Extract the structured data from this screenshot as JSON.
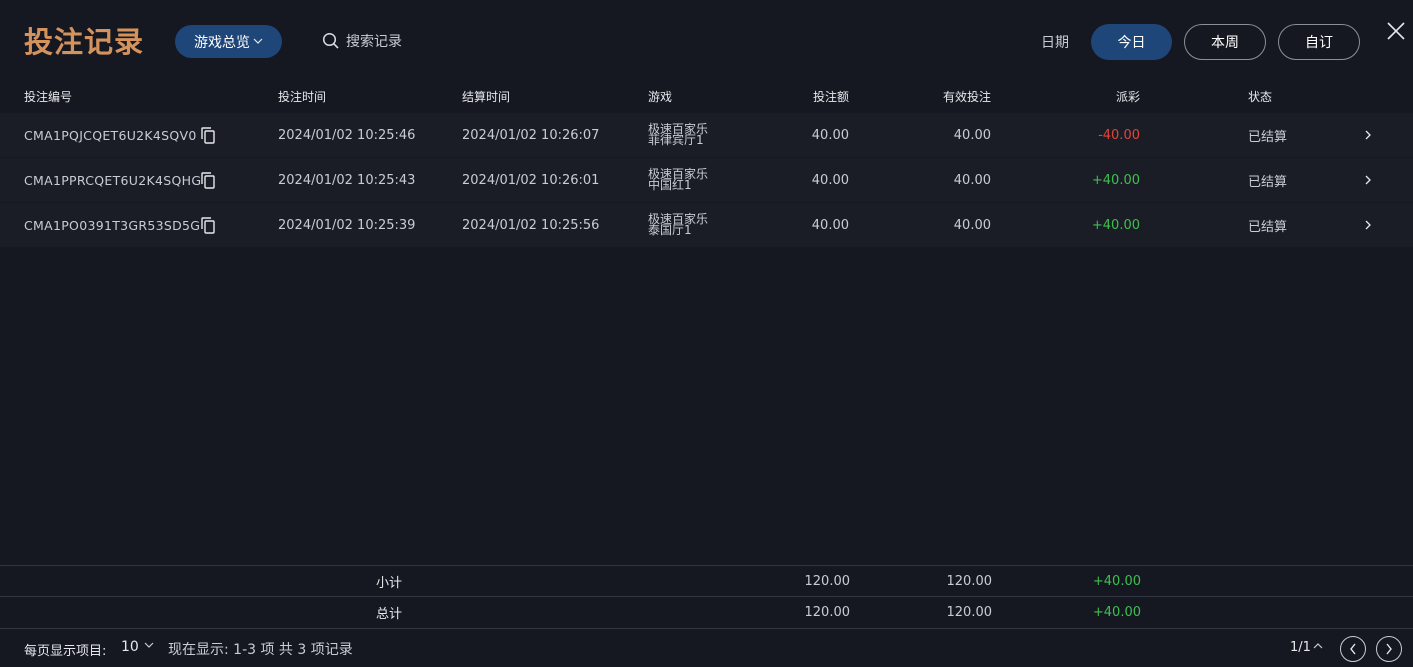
{
  "header": {
    "title": "投注记录",
    "game_select": "游戏总览",
    "search_placeholder": "搜索记录",
    "date_label": "日期",
    "date_filters": [
      "今日",
      "本周",
      "自订"
    ],
    "active_filter": "今日"
  },
  "columns": [
    "投注编号",
    "投注时间",
    "结算时间",
    "游戏",
    "投注额",
    "有效投注",
    "派彩",
    "状态"
  ],
  "rows": [
    {
      "id": "CMA1PQJCQET6U2K4SQV0",
      "bet_time": "2024/01/02 10:25:46",
      "settle_time": "2024/01/02 10:26:07",
      "game_line1": "极速百家乐",
      "game_line2": "菲律宾厅1",
      "bet": "40.00",
      "valid": "40.00",
      "payout": "-40.00",
      "payout_sign": "neg",
      "status": "已结算"
    },
    {
      "id": "CMA1PPRCQET6U2K4SQHG",
      "bet_time": "2024/01/02 10:25:43",
      "settle_time": "2024/01/02 10:26:01",
      "game_line1": "极速百家乐",
      "game_line2": "中国红1",
      "bet": "40.00",
      "valid": "40.00",
      "payout": "+40.00",
      "payout_sign": "pos",
      "status": "已结算"
    },
    {
      "id": "CMA1PO0391T3GR53SD5G",
      "bet_time": "2024/01/02 10:25:39",
      "settle_time": "2024/01/02 10:25:56",
      "game_line1": "极速百家乐",
      "game_line2": "泰国厅1",
      "bet": "40.00",
      "valid": "40.00",
      "payout": "+40.00",
      "payout_sign": "pos",
      "status": "已结算"
    }
  ],
  "subtotal": {
    "label": "小计",
    "bet": "120.00",
    "valid": "120.00",
    "payout": "+40.00"
  },
  "total": {
    "label": "总计",
    "bet": "120.00",
    "valid": "120.00",
    "payout": "+40.00"
  },
  "footer": {
    "per_page_label": "每页显示项目:",
    "per_page_value": "10",
    "showing": "现在显示: 1-3 项 共 3 项记录",
    "page_indicator": "1/1"
  },
  "colors": {
    "accent": "#d4935d",
    "primary": "#1f4679",
    "negative": "#e0453a",
    "positive": "#3fbf4f"
  }
}
